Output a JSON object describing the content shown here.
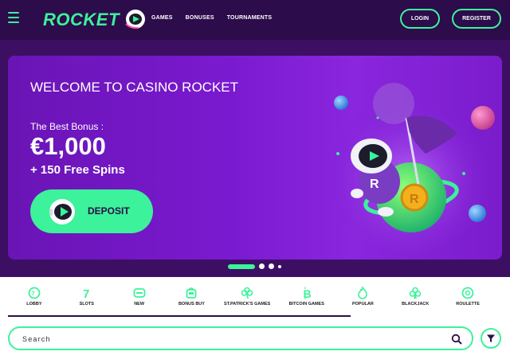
{
  "header": {
    "logo_text": "ROCKET",
    "nav": [
      {
        "label": "GAMES"
      },
      {
        "label": "BONUSES"
      },
      {
        "label": "TOURNAMENTS"
      }
    ],
    "login_label": "LOGIN",
    "register_label": "REGISTER"
  },
  "banner": {
    "title": "WELCOME TO CASINO ROCKET",
    "bonus_label": "The Best Bonus :",
    "bonus_amount": "€1,000",
    "bonus_spins": "+ 150 Free Spins",
    "deposit_label": "DEPOSIT"
  },
  "carousel": {
    "slides": 4,
    "active_index": 0
  },
  "categories": [
    {
      "label": "LOBBY",
      "icon": "lobby-icon"
    },
    {
      "label": "SLOTS",
      "icon": "slots-icon"
    },
    {
      "label": "NEW",
      "icon": "new-icon"
    },
    {
      "label": "BONUS BUY",
      "icon": "bonus-buy-icon"
    },
    {
      "label": "ST.PATRICK'S GAMES",
      "icon": "clover-icon"
    },
    {
      "label": "BITCOIN GAMES",
      "icon": "bitcoin-icon"
    },
    {
      "label": "POPULAR",
      "icon": "flame-icon"
    },
    {
      "label": "BLACKJACK",
      "icon": "club-icon"
    },
    {
      "label": "ROULETTE",
      "icon": "roulette-icon"
    }
  ],
  "search": {
    "placeholder": "Search"
  },
  "colors": {
    "accent": "#3cf29a",
    "header_bg": "#2c0c4a",
    "banner_bg": "#7a1ad0",
    "hero_band": "#3d0f63"
  }
}
